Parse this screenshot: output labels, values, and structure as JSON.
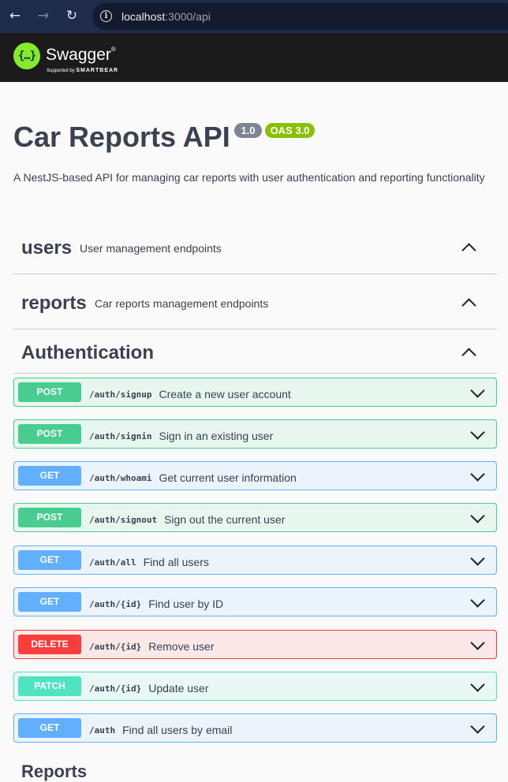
{
  "browser": {
    "back_icon": "arrow-left-icon",
    "forward_icon": "arrow-right-icon",
    "reload_icon": "reload-icon",
    "info_icon": "info-icon",
    "url_host": "localhost",
    "url_path": ":3000/api"
  },
  "swagger": {
    "logo_glyph": "{…}",
    "brand": "Swagger",
    "reg_mark": "®",
    "supported_by": "Supported by",
    "smartbear": "SMARTBEAR"
  },
  "info": {
    "title": "Car Reports API",
    "version": "1.0",
    "oas": "OAS 3.0",
    "description": "A NestJS-based API for managing car reports with user authentication and reporting functionality"
  },
  "tags": [
    {
      "name": "users",
      "description": "User management endpoints"
    },
    {
      "name": "reports",
      "description": "Car reports management endpoints"
    },
    {
      "name": "Authentication",
      "description": ""
    }
  ],
  "operations": [
    {
      "method": "POST",
      "path": "/auth/signup",
      "summary": "Create a new user account"
    },
    {
      "method": "POST",
      "path": "/auth/signin",
      "summary": "Sign in an existing user"
    },
    {
      "method": "GET",
      "path": "/auth/whoami",
      "summary": "Get current user information"
    },
    {
      "method": "POST",
      "path": "/auth/signout",
      "summary": "Sign out the current user"
    },
    {
      "method": "GET",
      "path": "/auth/all",
      "summary": "Find all users"
    },
    {
      "method": "GET",
      "path": "/auth/{id}",
      "summary": "Find user by ID"
    },
    {
      "method": "DELETE",
      "path": "/auth/{id}",
      "summary": "Remove user"
    },
    {
      "method": "PATCH",
      "path": "/auth/{id}",
      "summary": "Update user"
    },
    {
      "method": "GET",
      "path": "/auth",
      "summary": "Find all users by email"
    }
  ],
  "next_tag_partial": "Reports",
  "colors": {
    "post": "#49cc90",
    "get": "#61affe",
    "delete": "#f93e3e",
    "patch": "#50e3c2",
    "swagger_green": "#85ea2d",
    "oas_badge": "#89bf04"
  }
}
